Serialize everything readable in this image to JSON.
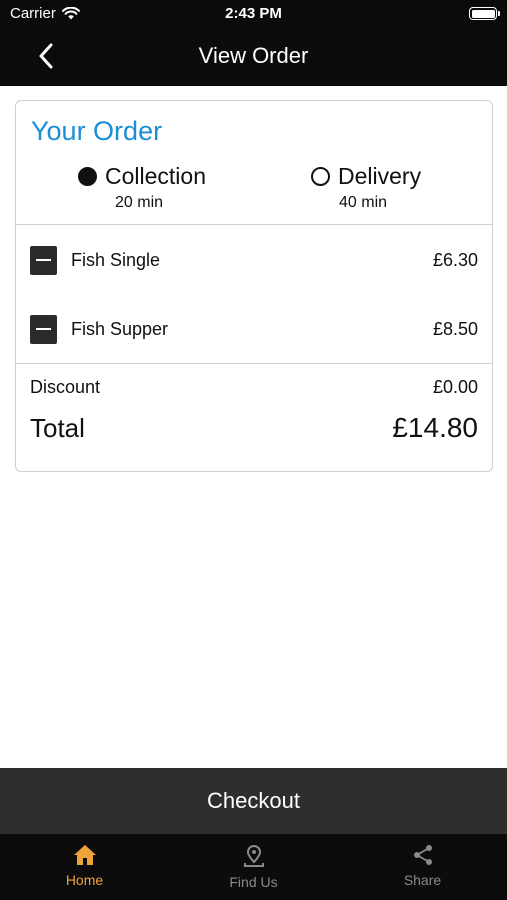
{
  "status": {
    "carrier": "Carrier",
    "time": "2:43 PM"
  },
  "nav": {
    "title": "View Order"
  },
  "order": {
    "heading": "Your Order",
    "options": [
      {
        "label": "Collection",
        "time": "20 min",
        "selected": true
      },
      {
        "label": "Delivery",
        "time": "40 min",
        "selected": false
      }
    ],
    "items": [
      {
        "name": "Fish Single",
        "price": "£6.30"
      },
      {
        "name": "Fish Supper",
        "price": "£8.50"
      }
    ],
    "discount_label": "Discount",
    "discount_value": "£0.00",
    "total_label": "Total",
    "total_value": "£14.80"
  },
  "checkout_label": "Checkout",
  "tabs": [
    {
      "label": "Home",
      "icon": "home-icon",
      "active": true
    },
    {
      "label": "Find Us",
      "icon": "map-pin-icon",
      "active": false
    },
    {
      "label": "Share",
      "icon": "share-icon",
      "active": false
    }
  ],
  "colors": {
    "accent": "#1a8fd6",
    "tab_active": "#f0a23a",
    "bar": "#0b0b0b",
    "checkout": "#2e2e2e"
  }
}
